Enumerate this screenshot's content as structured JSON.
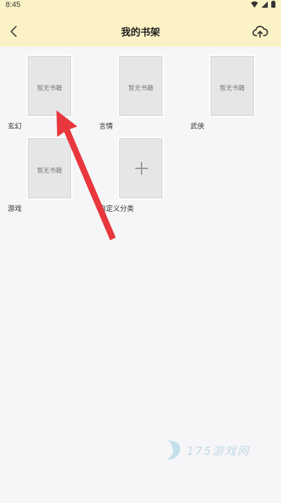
{
  "status_bar": {
    "time": "8:45",
    "icons": [
      "wifi-icon",
      "signal-icon",
      "battery-icon"
    ]
  },
  "header": {
    "title": "我的书架",
    "back_icon": "chevron-left-icon",
    "upload_icon": "cloud-upload-icon",
    "background": "#fbf2c6"
  },
  "shelf": {
    "empty_cover_text": "暂无书籍",
    "categories": [
      {
        "label": "玄幻",
        "cover": "暂无书籍"
      },
      {
        "label": "言情",
        "cover": "暂无书籍"
      },
      {
        "label": "武侠",
        "cover": "暂无书籍"
      },
      {
        "label": "游戏",
        "cover": "暂无书籍"
      },
      {
        "label": "自定义分类",
        "cover": "add-icon"
      }
    ]
  },
  "annotation": {
    "arrow_color": "#e8383d"
  },
  "watermark": {
    "text": "175游戏网"
  }
}
